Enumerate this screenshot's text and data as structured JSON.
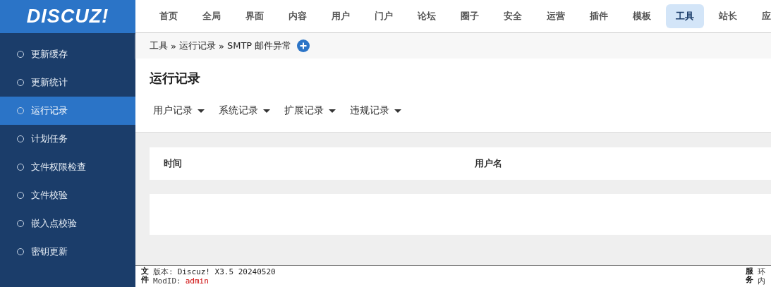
{
  "logo": {
    "text": "DISCUZ!"
  },
  "top_nav": [
    {
      "label": "首页",
      "selected": false
    },
    {
      "label": "全局",
      "selected": false
    },
    {
      "label": "界面",
      "selected": false
    },
    {
      "label": "内容",
      "selected": false
    },
    {
      "label": "用户",
      "selected": false
    },
    {
      "label": "门户",
      "selected": false
    },
    {
      "label": "论坛",
      "selected": false
    },
    {
      "label": "圈子",
      "selected": false
    },
    {
      "label": "安全",
      "selected": false
    },
    {
      "label": "运营",
      "selected": false
    },
    {
      "label": "插件",
      "selected": false
    },
    {
      "label": "模板",
      "selected": false
    },
    {
      "label": "工具",
      "selected": true
    },
    {
      "label": "站长",
      "selected": false
    },
    {
      "label": "应",
      "selected": false
    }
  ],
  "sidebar": {
    "items": [
      {
        "label": "更新缓存",
        "selected": false
      },
      {
        "label": "更新统计",
        "selected": false
      },
      {
        "label": "运行记录",
        "selected": true
      },
      {
        "label": "计划任务",
        "selected": false
      },
      {
        "label": "文件权限检查",
        "selected": false
      },
      {
        "label": "文件校验",
        "selected": false
      },
      {
        "label": "嵌入点校验",
        "selected": false
      },
      {
        "label": "密钥更新",
        "selected": false
      }
    ]
  },
  "breadcrumb": {
    "separator": "»",
    "items": [
      "工具",
      "运行记录",
      "SMTP 邮件异常"
    ]
  },
  "page_title": "运行记录",
  "filter_menus": [
    "用户记录",
    "系统记录",
    "扩展记录",
    "违规记录"
  ],
  "table": {
    "columns": [
      "时间",
      "用户名"
    ]
  },
  "footer": {
    "left": {
      "label": "文件",
      "lines": [
        {
          "label": "版本:",
          "value": "Discuz! X3.5 20240520",
          "highlighted": false
        },
        {
          "label": "ModID:",
          "value": "admin",
          "highlighted": true
        }
      ]
    },
    "right": {
      "label": "服务",
      "lines": [
        "环",
        "内"
      ]
    }
  }
}
